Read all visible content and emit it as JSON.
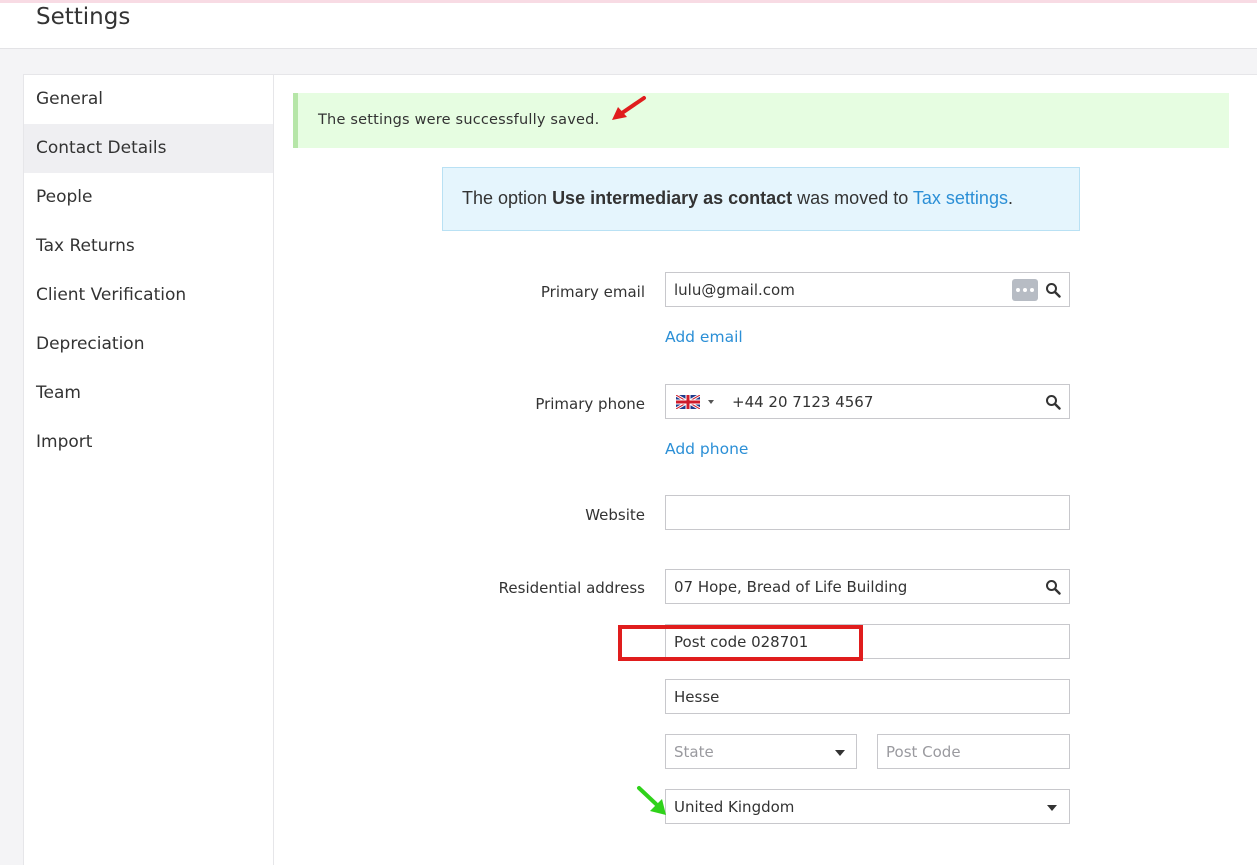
{
  "header": {
    "title": "Settings"
  },
  "sidebar": {
    "items": [
      {
        "label": "General",
        "active": false
      },
      {
        "label": "Contact Details",
        "active": true
      },
      {
        "label": "People",
        "active": false
      },
      {
        "label": "Tax Returns",
        "active": false
      },
      {
        "label": "Client Verification",
        "active": false
      },
      {
        "label": "Depreciation",
        "active": false
      },
      {
        "label": "Team",
        "active": false
      },
      {
        "label": "Import",
        "active": false
      }
    ]
  },
  "alerts": {
    "success": "The settings were successfully saved.",
    "info": {
      "prefix": "The option ",
      "bold": "Use intermediary as contact",
      "middle": " was moved to ",
      "link": "Tax settings",
      "suffix": "."
    }
  },
  "form": {
    "primary_email": {
      "label": "Primary email",
      "value": "lulu@gmail.com",
      "add_label": "Add email"
    },
    "primary_phone": {
      "label": "Primary phone",
      "country": "GB",
      "value": "+44 20 7123 4567",
      "add_label": "Add phone"
    },
    "website": {
      "label": "Website",
      "value": ""
    },
    "residential_address": {
      "label": "Residential address",
      "line1": "07 Hope, Bread of Life Building",
      "line2": "Post code 028701",
      "city": "Hesse",
      "state_placeholder": "State",
      "postcode_placeholder": "Post Code",
      "country": "United Kingdom"
    }
  },
  "annotation_colors": {
    "red": "#e01d1d",
    "green": "#2fd21a"
  }
}
